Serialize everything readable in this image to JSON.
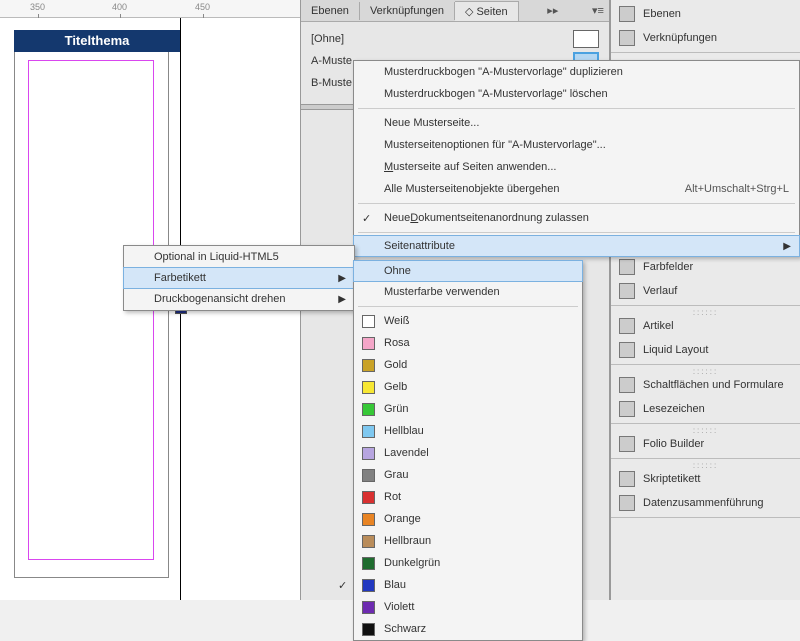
{
  "ruler_ticks": [
    "350",
    "400",
    "450"
  ],
  "artboard_title": "Titelthema",
  "panel_tabs": {
    "layers": "Ebenen",
    "links": "Verknüpfungen",
    "pages": "Seiten"
  },
  "masters": {
    "none": "[Ohne]",
    "a": "A-Mustervorlage",
    "b": "B-Mustervorlage",
    "a_short": "A-Muste",
    "b_short": "B-Muste"
  },
  "ctx_main": {
    "dup": "Musterdruckbogen \"A-Mustervorlage\" duplizieren",
    "del": "Musterdruckbogen \"A-Mustervorlage\" löschen",
    "new": "Neue Musterseite...",
    "opts": "Musterseitenoptionen für \"A-Mustervorlage\"...",
    "apply": "Musterseite auf Seiten anwenden...",
    "override": "Alle Musterseitenobjekte übergehen",
    "override_accel": "Alt+Umschalt+Strg+L",
    "allow": "Neue Dokumentseitenanordnung zulassen",
    "pageattr": "Seitenattribute"
  },
  "ctx_left": {
    "optional": "Optional in Liquid-HTML5",
    "farbe": "Farbetikett",
    "rotate": "Druckbogenansicht drehen"
  },
  "color_menu": {
    "none": "Ohne",
    "usemaster": "Musterfarbe verwenden",
    "colors": [
      {
        "name": "Weiß",
        "hex": "#ffffff"
      },
      {
        "name": "Rosa",
        "hex": "#f4a6c8"
      },
      {
        "name": "Gold",
        "hex": "#c9a227"
      },
      {
        "name": "Gelb",
        "hex": "#f7e733"
      },
      {
        "name": "Grün",
        "hex": "#37c837"
      },
      {
        "name": "Hellblau",
        "hex": "#7fc8f0"
      },
      {
        "name": "Lavendel",
        "hex": "#b7a5e0"
      },
      {
        "name": "Grau",
        "hex": "#808080"
      },
      {
        "name": "Rot",
        "hex": "#d83030"
      },
      {
        "name": "Orange",
        "hex": "#e88424"
      },
      {
        "name": "Hellbraun",
        "hex": "#b98c5a"
      },
      {
        "name": "Dunkelgrün",
        "hex": "#1e6b2e"
      },
      {
        "name": "Blau",
        "hex": "#2238c0"
      },
      {
        "name": "Violett",
        "hex": "#6d2bb0"
      },
      {
        "name": "Schwarz",
        "hex": "#101010"
      }
    ],
    "selected": "Blau"
  },
  "dock": {
    "ebenen": "Ebenen",
    "verkn": "Verknüpfungen",
    "farbfelder": "Farbfelder",
    "verlauf": "Verlauf",
    "artikel": "Artikel",
    "liquid": "Liquid Layout",
    "schalt": "Schaltflächen und Formulare",
    "lesez": "Lesezeichen",
    "folio": "Folio Builder",
    "skript": "Skriptetikett",
    "daten": "Datenzusammenführung"
  }
}
